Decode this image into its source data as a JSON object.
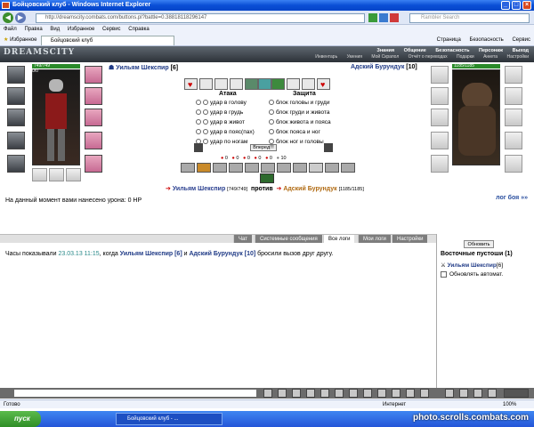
{
  "window": {
    "title": "Бойцовский клуб - Windows Internet Explorer"
  },
  "address": {
    "url": "http://dreamscity.combats.com/buttons.pl?battle=0.38818118296147",
    "search_placeholder": "Rambler Search"
  },
  "menu": [
    "Файл",
    "Правка",
    "Вид",
    "Избранное",
    "Сервис",
    "Справка"
  ],
  "favbar": {
    "favorites": "Избранное",
    "tab": "Бойцовский клуб",
    "commands": [
      "Страница",
      "Безопасность",
      "Сервис"
    ]
  },
  "game": {
    "logo": "DREAMSCITY",
    "topmenu": [
      "Знания",
      "Общение",
      "Безопасность",
      "Персонаж",
      "Выход"
    ],
    "submenu": [
      "Инвентарь",
      "Умения",
      "Мой Скрапол",
      "Отчёт о переводах",
      "Подарки",
      "Анкета",
      "Настройки"
    ]
  },
  "player1": {
    "name": "Уильям Шекспир",
    "level": "[6]",
    "hp": "749/749",
    "hp_fraction": 1.0,
    "stat": "0/0"
  },
  "player2": {
    "name": "Адский Бурундук",
    "level": "[10]",
    "hp": "1185/1185",
    "hp_fraction": 1.0
  },
  "combat": {
    "attack_header": "Атака",
    "defense_header": "Защита",
    "attacks": [
      "удар в голову",
      "удар в грудь",
      "удар в живот",
      "удар в пояс(пах)",
      "удар по ногам"
    ],
    "blocks": [
      "блок головы и груди",
      "блок груди и живота",
      "блок живота и пояса",
      "блок пояса и ног",
      "блок ног и головы"
    ],
    "go_button": "Вперед!!!",
    "counters": [
      "0",
      "0",
      "0",
      "0",
      "0",
      "10"
    ]
  },
  "versus": {
    "p1": "Уильям Шекспир",
    "p1_hp": "[749/749]",
    "word": "против",
    "p2": "Адский Бурундук",
    "p2_hp": "[1185/1185]"
  },
  "damage_text": "На данный момент вами нанесено урона: 0 HP",
  "battle_log_link": "лог боя »»",
  "tabs": [
    "Чат",
    "Системные сообщения",
    "Все логи",
    "Мои логи",
    "Настройки"
  ],
  "chat": {
    "pre": "Часы показывали ",
    "time": "23.03.13 11:15",
    "mid": ", когда ",
    "p1": "Уильям Шекспир [6]",
    "and": " и ",
    "p2": "Адский Бурундук [10]",
    "post": " бросили вызов друг другу."
  },
  "rightpanel": {
    "refresh": "Обновить",
    "location": "Восточные пустоши (1)",
    "player": "Уильям Шекспир",
    "player_level": "[6]",
    "auto": "Обновлять автомат."
  },
  "status": {
    "left": "Готово",
    "zone": "Интернет",
    "zoom": "100%"
  },
  "taskbar": {
    "start": "пуск",
    "task": "Бойцовский клуб - ...",
    "watermark": "photo.scrolls.combats.com"
  }
}
